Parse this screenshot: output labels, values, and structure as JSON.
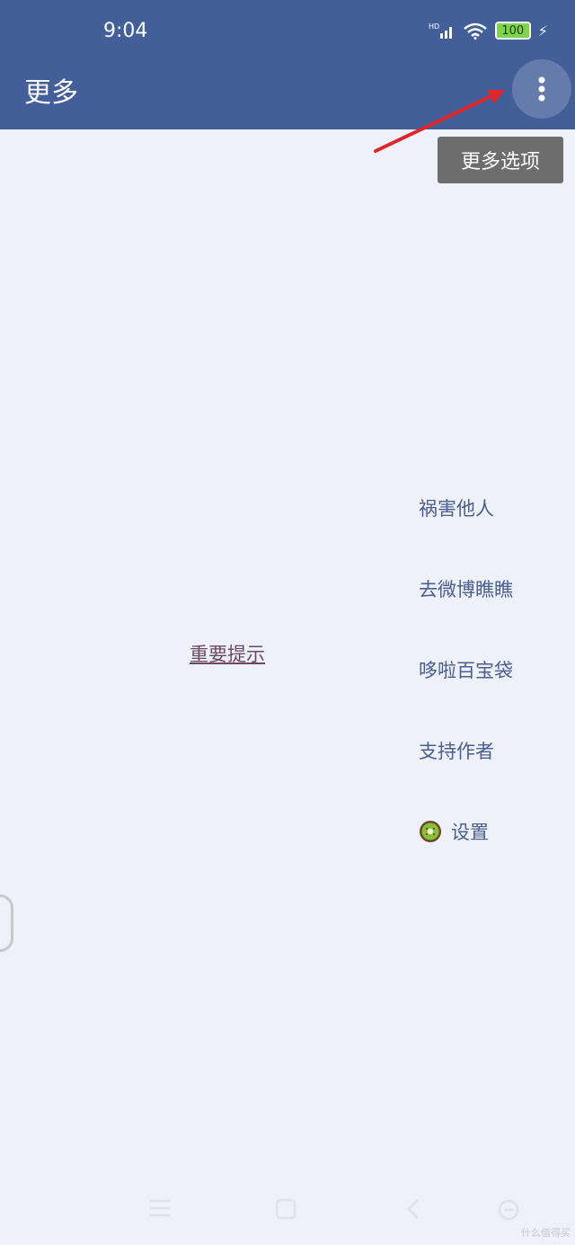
{
  "status": {
    "time": "9:04",
    "battery": "100",
    "network": "HD"
  },
  "app_bar": {
    "title": "更多"
  },
  "tooltip": {
    "text": "更多选项"
  },
  "menu": {
    "items": [
      {
        "label": "祸害他人"
      },
      {
        "label": "去微博瞧瞧"
      },
      {
        "label": "哆啦百宝袋"
      },
      {
        "label": "支持作者"
      },
      {
        "label": "设置",
        "icon": "kiwi-icon"
      }
    ]
  },
  "notice": {
    "label": "重要提示"
  },
  "watermark": {
    "text": "什么值得买"
  },
  "colors": {
    "app_bar": "#435f9a",
    "background": "#eef0fa",
    "menu_text": "#4a5f8e",
    "tooltip": "#6d6d6d",
    "arrow": "#e0262a"
  }
}
